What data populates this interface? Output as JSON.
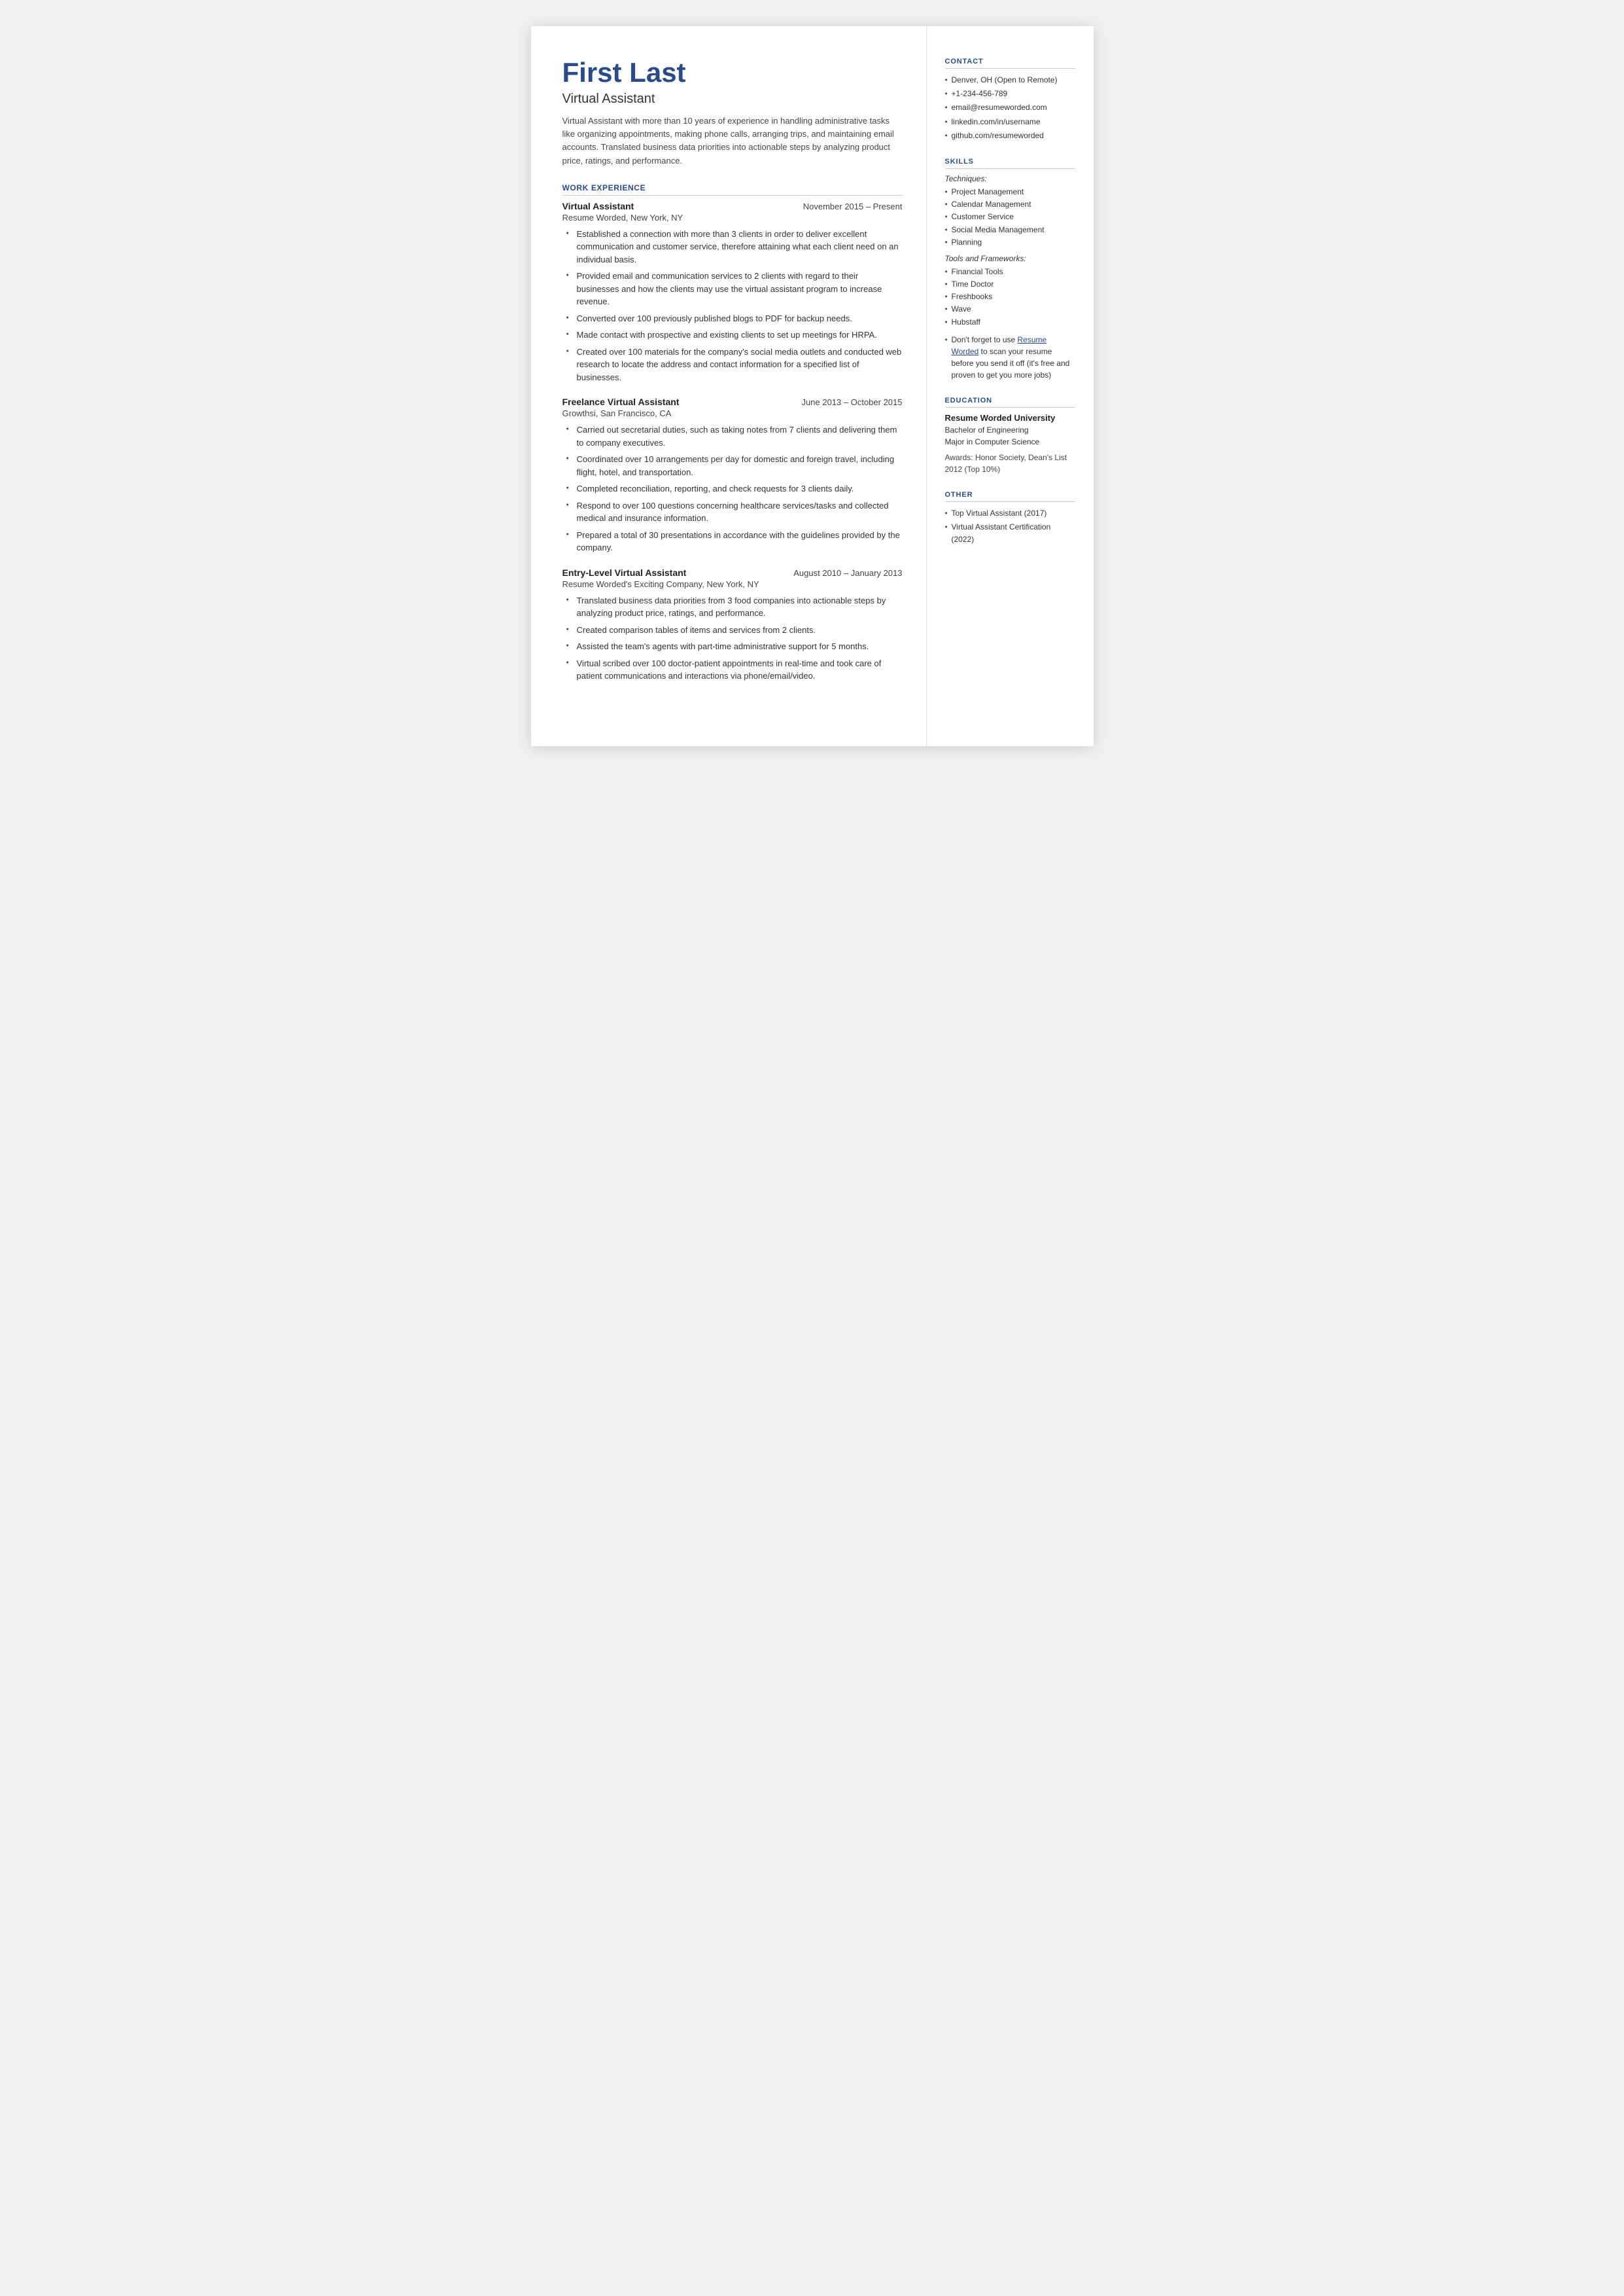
{
  "header": {
    "name": "First Last",
    "job_title": "Virtual Assistant",
    "summary": "Virtual Assistant with more than 10 years of experience in handling administrative tasks like organizing appointments, making phone calls, arranging trips, and maintaining email accounts. Translated business data priorities into actionable steps by analyzing product price, ratings, and performance."
  },
  "work_experience": {
    "section_label": "WORK EXPERIENCE",
    "jobs": [
      {
        "title": "Virtual Assistant",
        "dates": "November 2015 – Present",
        "company": "Resume Worded, New York, NY",
        "bullets": [
          "Established a connection with more than 3 clients in order to deliver excellent communication and customer service, therefore attaining what each client need on an individual basis.",
          "Provided email and communication services to 2 clients with regard to their businesses and how the clients may use the virtual assistant program to increase revenue.",
          "Converted over 100 previously published blogs to PDF for backup needs.",
          "Made contact with prospective and existing clients to set up meetings for HRPA.",
          "Created over 100 materials for the company's social media outlets and conducted web research to locate the address and contact information for a specified list of businesses."
        ]
      },
      {
        "title": "Freelance Virtual Assistant",
        "dates": "June 2013 – October 2015",
        "company": "Growthsi, San Francisco, CA",
        "bullets": [
          "Carried out secretarial duties, such as taking notes from 7 clients and delivering them to company executives.",
          "Coordinated over 10 arrangements per day for domestic and foreign travel, including flight, hotel, and transportation.",
          "Completed reconciliation, reporting, and check requests for 3 clients daily.",
          "Respond to over 100 questions concerning healthcare services/tasks and collected medical and insurance information.",
          "Prepared a total of 30 presentations in accordance with the guidelines provided by the company."
        ]
      },
      {
        "title": "Entry-Level Virtual Assistant",
        "dates": "August 2010 – January 2013",
        "company": "Resume Worded's Exciting Company, New York, NY",
        "bullets": [
          "Translated business data priorities from 3 food companies into actionable steps by analyzing product price, ratings, and performance.",
          "Created comparison tables of items and services from 2 clients.",
          "Assisted the team's agents with part-time administrative support for 5 months.",
          "Virtual scribed over 100 doctor-patient appointments in real-time and took care of patient communications and interactions via phone/email/video."
        ]
      }
    ]
  },
  "contact": {
    "section_label": "CONTACT",
    "items": [
      "Denver, OH (Open to Remote)",
      "+1-234-456-789",
      "email@resumeworded.com",
      "linkedin.com/in/username",
      "github.com/resumeworded"
    ]
  },
  "skills": {
    "section_label": "SKILLS",
    "techniques_label": "Techniques:",
    "techniques": [
      "Project Management",
      "Calendar Management",
      "Customer Service",
      "Social Media Management",
      "Planning"
    ],
    "tools_label": "Tools and Frameworks:",
    "tools": [
      "Financial Tools",
      "Time Doctor",
      "Freshbooks",
      "Wave",
      "Hubstaff"
    ],
    "note_prefix": "Don't forget to use ",
    "note_link_text": "Resume Worded",
    "note_suffix": " to scan your resume before you send it off (it's free and proven to get you more jobs)"
  },
  "education": {
    "section_label": "EDUCATION",
    "school": "Resume Worded University",
    "degree_line1": "Bachelor of Engineering",
    "degree_line2": "Major in Computer Science",
    "awards": "Awards: Honor Society, Dean's List 2012 (Top 10%)"
  },
  "other": {
    "section_label": "OTHER",
    "items": [
      "Top Virtual Assistant (2017)",
      "Virtual Assistant Certification (2022)"
    ]
  }
}
